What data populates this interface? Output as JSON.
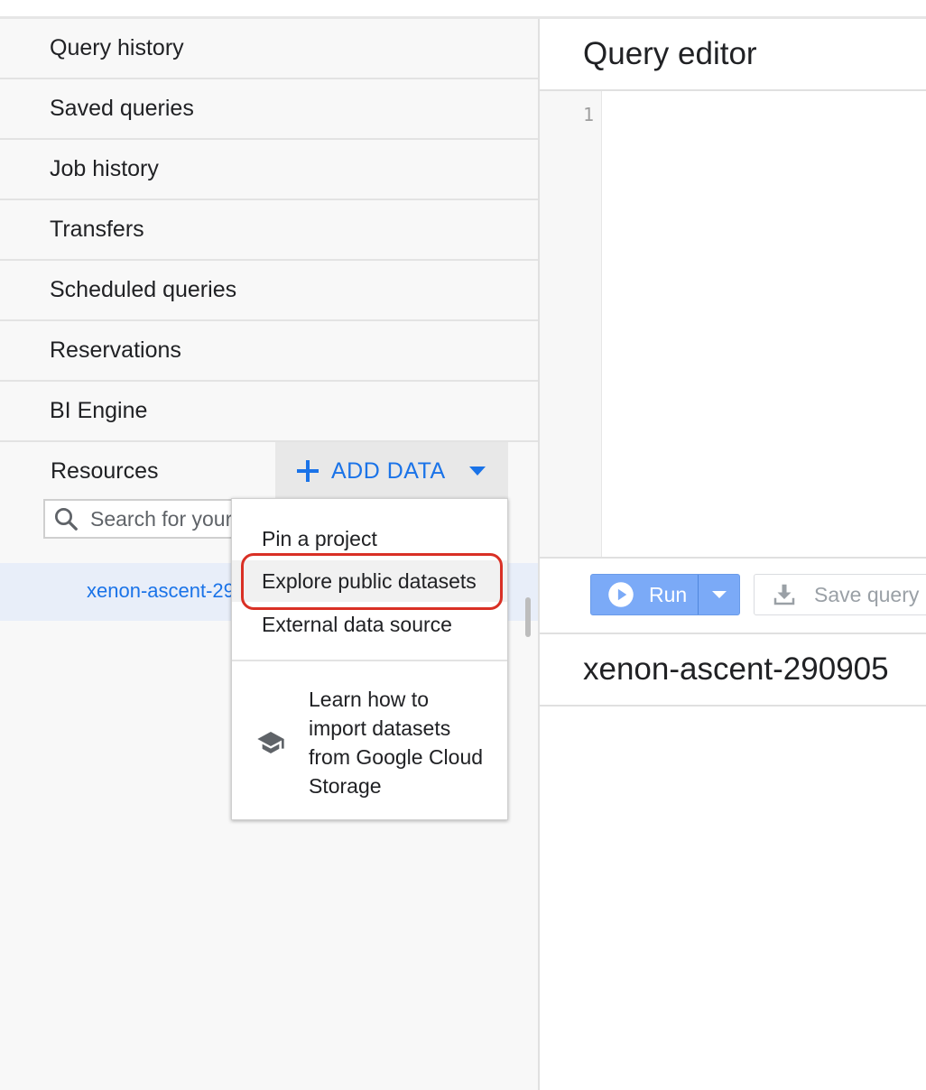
{
  "sidebar": {
    "items": [
      {
        "label": "Query history"
      },
      {
        "label": "Saved queries"
      },
      {
        "label": "Job history"
      },
      {
        "label": "Transfers"
      },
      {
        "label": "Scheduled queries"
      },
      {
        "label": "Reservations"
      },
      {
        "label": "BI Engine"
      }
    ],
    "resources_label": "Resources",
    "add_data_label": "ADD DATA",
    "search": {
      "placeholder": "Search for your"
    },
    "project_name": "xenon-ascent-290905"
  },
  "add_data_menu": {
    "items": [
      {
        "label": "Pin a project"
      },
      {
        "label": "Explore public datasets"
      },
      {
        "label": "External data source"
      }
    ],
    "learn_text": "Learn how to import datasets from Google Cloud Storage"
  },
  "editor": {
    "title": "Query editor",
    "line_number": "1",
    "run_label": "Run",
    "save_label": "Save query",
    "results_title": "xenon-ascent-290905"
  },
  "colors": {
    "accent": "#1a73e8",
    "highlight_border": "#d93025",
    "run_button": "#7baaf7"
  }
}
